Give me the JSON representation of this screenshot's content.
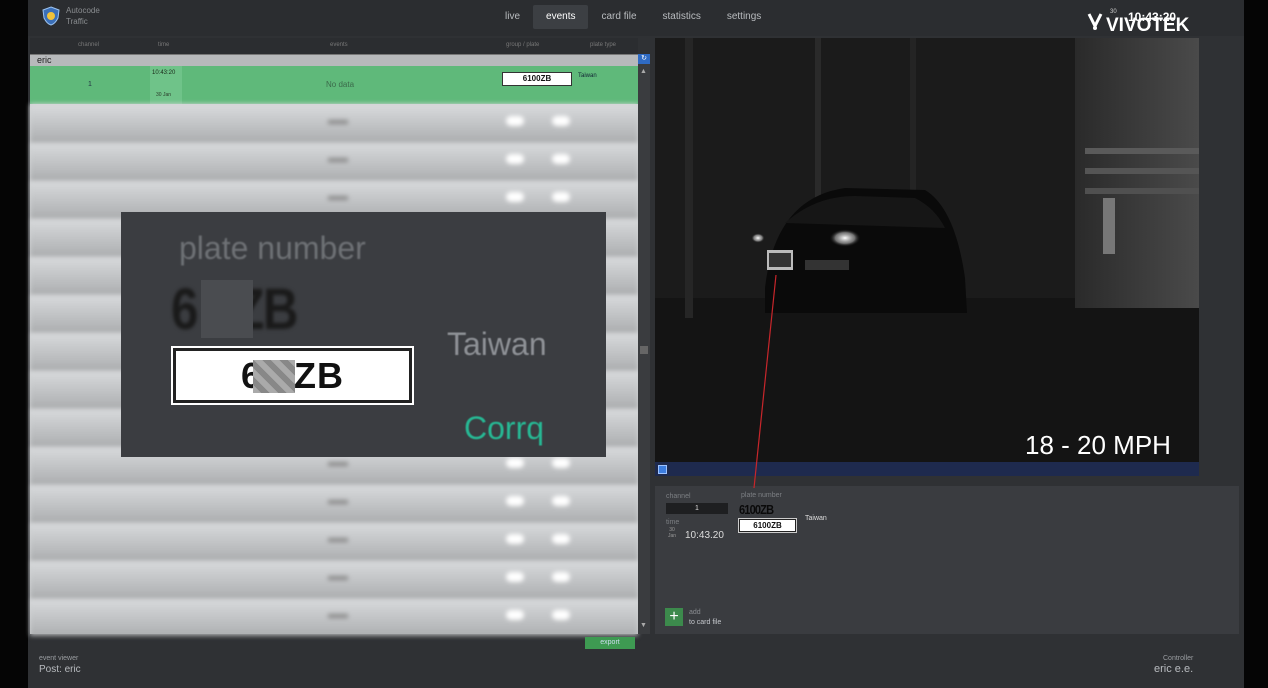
{
  "header": {
    "app_line1": "Autocode",
    "app_line2": "Traffic",
    "tabs": [
      {
        "label": "live",
        "active": false
      },
      {
        "label": "events",
        "active": true
      },
      {
        "label": "card file",
        "active": false
      },
      {
        "label": "statistics",
        "active": false
      },
      {
        "label": "settings",
        "active": false
      }
    ],
    "brand": "VIVOTEK",
    "clock": "10:43:20",
    "clock_date": "30"
  },
  "event_list": {
    "columns": [
      "channel",
      "time",
      "events",
      "group / plate",
      "plate type"
    ],
    "group_name": "eric",
    "selected_row": {
      "channel": "1",
      "time": "10:43:20",
      "time_sub": "30 Jan",
      "event": "No data",
      "plate": "6100ZB",
      "country": "Taiwan"
    },
    "export_label": "export"
  },
  "zoom_overlay": {
    "title": "plate number",
    "plate_image_text": "6  0ZB",
    "plate_recognized": "6  0ZB",
    "country": "Taiwan",
    "status": "Corrq"
  },
  "camera": {
    "speed": "18 - 20 MPH"
  },
  "detail": {
    "channel_label": "channel",
    "channel_value": "1",
    "time_label": "time",
    "time_cal_day": "30",
    "time_cal_month": "Jan",
    "time_value": "10:43.20",
    "plate_label": "plate number",
    "plate_image_text": "6100ZB",
    "plate_value": "6100ZB",
    "country": "Taiwan",
    "add_line1": "add",
    "add_line2": "to card file"
  },
  "footer": {
    "left_label": "event viewer",
    "left_value": "Post: eric",
    "right_label": "Controller",
    "right_value": "eric e.e."
  },
  "colors": {
    "selected_row": "#5fb97a",
    "status_green": "#27b894",
    "accent_blue": "#2f6bc4"
  }
}
